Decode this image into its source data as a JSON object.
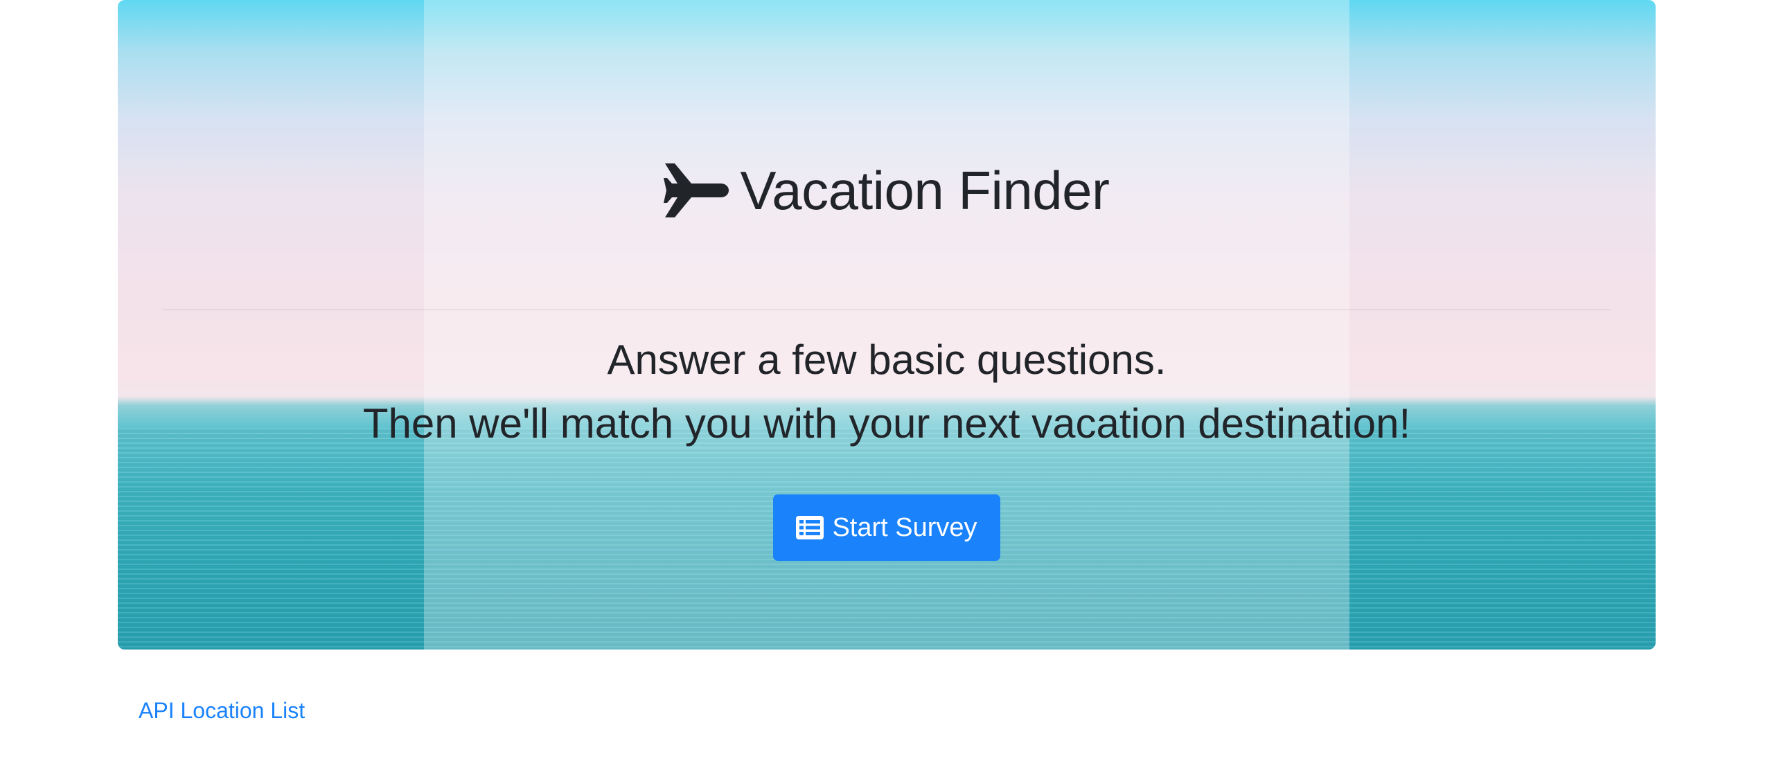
{
  "hero": {
    "title": "Vacation Finder",
    "title_icon": "airplane-icon",
    "lead_line_1": "Answer a few basic questions.",
    "lead_line_2": "Then we'll match you with your next vacation destination!",
    "start_button": {
      "label": "Start Survey",
      "icon": "list-icon",
      "color": "#1a82fb"
    }
  },
  "footer": {
    "api_link_label": "API Location List",
    "link_color": "#1a82fb"
  }
}
